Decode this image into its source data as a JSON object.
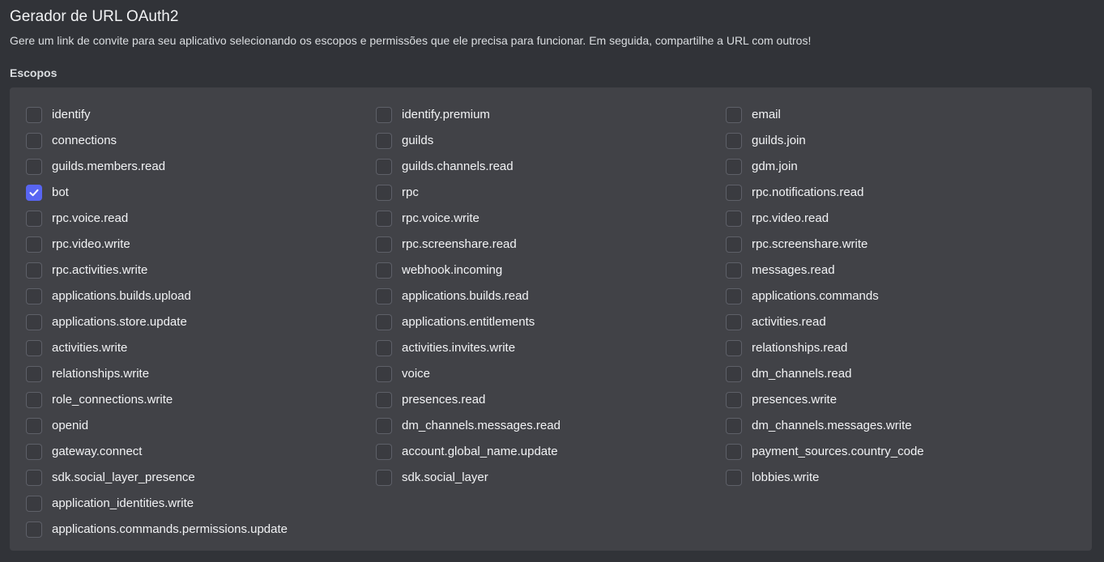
{
  "header": {
    "title": "Gerador de URL OAuth2",
    "description": "Gere um link de convite para seu aplicativo selecionando os escopos e permissões que ele precisa para funcionar. Em seguida, compartilhe a URL com outros!"
  },
  "scopes": {
    "label": "Escopos",
    "items": [
      {
        "label": "identify",
        "checked": false
      },
      {
        "label": "identify.premium",
        "checked": false
      },
      {
        "label": "email",
        "checked": false
      },
      {
        "label": "connections",
        "checked": false
      },
      {
        "label": "guilds",
        "checked": false
      },
      {
        "label": "guilds.join",
        "checked": false
      },
      {
        "label": "guilds.members.read",
        "checked": false
      },
      {
        "label": "guilds.channels.read",
        "checked": false
      },
      {
        "label": "gdm.join",
        "checked": false
      },
      {
        "label": "bot",
        "checked": true
      },
      {
        "label": "rpc",
        "checked": false
      },
      {
        "label": "rpc.notifications.read",
        "checked": false
      },
      {
        "label": "rpc.voice.read",
        "checked": false
      },
      {
        "label": "rpc.voice.write",
        "checked": false
      },
      {
        "label": "rpc.video.read",
        "checked": false
      },
      {
        "label": "rpc.video.write",
        "checked": false
      },
      {
        "label": "rpc.screenshare.read",
        "checked": false
      },
      {
        "label": "rpc.screenshare.write",
        "checked": false
      },
      {
        "label": "rpc.activities.write",
        "checked": false
      },
      {
        "label": "webhook.incoming",
        "checked": false
      },
      {
        "label": "messages.read",
        "checked": false
      },
      {
        "label": "applications.builds.upload",
        "checked": false
      },
      {
        "label": "applications.builds.read",
        "checked": false
      },
      {
        "label": "applications.commands",
        "checked": false
      },
      {
        "label": "applications.store.update",
        "checked": false
      },
      {
        "label": "applications.entitlements",
        "checked": false
      },
      {
        "label": "activities.read",
        "checked": false
      },
      {
        "label": "activities.write",
        "checked": false
      },
      {
        "label": "activities.invites.write",
        "checked": false
      },
      {
        "label": "relationships.read",
        "checked": false
      },
      {
        "label": "relationships.write",
        "checked": false
      },
      {
        "label": "voice",
        "checked": false
      },
      {
        "label": "dm_channels.read",
        "checked": false
      },
      {
        "label": "role_connections.write",
        "checked": false
      },
      {
        "label": "presences.read",
        "checked": false
      },
      {
        "label": "presences.write",
        "checked": false
      },
      {
        "label": "openid",
        "checked": false
      },
      {
        "label": "dm_channels.messages.read",
        "checked": false
      },
      {
        "label": "dm_channels.messages.write",
        "checked": false
      },
      {
        "label": "gateway.connect",
        "checked": false
      },
      {
        "label": "account.global_name.update",
        "checked": false
      },
      {
        "label": "payment_sources.country_code",
        "checked": false
      },
      {
        "label": "sdk.social_layer_presence",
        "checked": false
      },
      {
        "label": "sdk.social_layer",
        "checked": false
      },
      {
        "label": "lobbies.write",
        "checked": false
      },
      {
        "label": "application_identities.write",
        "checked": false
      },
      {
        "label": "",
        "checked": null
      },
      {
        "label": "",
        "checked": null
      },
      {
        "label": "applications.commands.permissions.update",
        "checked": false
      }
    ]
  },
  "colors": {
    "accent": "#5865f2",
    "background": "#313338",
    "panel": "#414247"
  }
}
